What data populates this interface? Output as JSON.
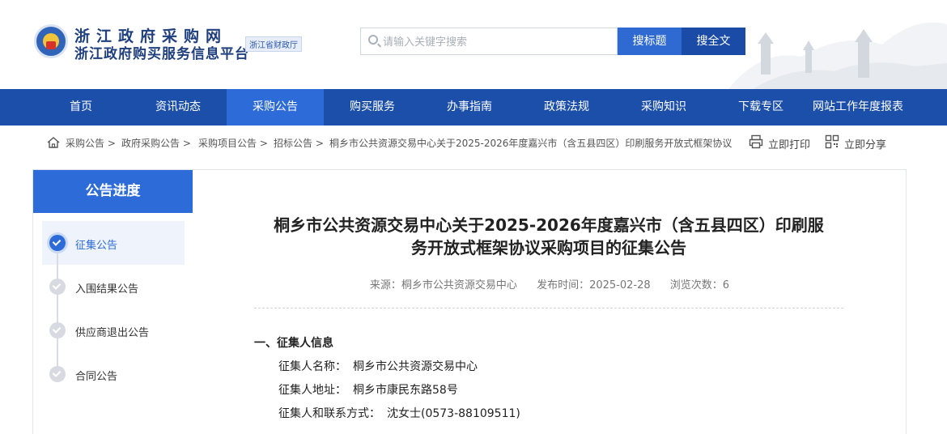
{
  "header": {
    "site_name": "浙江政府采购网",
    "site_sub": "浙江政府购买服务信息平台",
    "badge": "浙江省财政厅",
    "search_placeholder": "请输入关键字搜索",
    "btn_title": "搜标题",
    "btn_full": "搜全文"
  },
  "nav": {
    "items": [
      "首页",
      "资讯动态",
      "采购公告",
      "购买服务",
      "办事指南",
      "政策法规",
      "采购知识",
      "下载专区",
      "网站工作年度报表"
    ],
    "active": "采购公告"
  },
  "breadcrumb": {
    "items": [
      "采购公告 >",
      "政府采购公告 >",
      "采购项目公告 >",
      "招标公告 >",
      "桐乡市公共资源交易中心关于2025-2026年度嘉兴市（含五县四区）印刷服务开放式框架协议"
    ],
    "print": "立即打印",
    "share": "立即分享"
  },
  "side": {
    "title": "公告进度",
    "steps": [
      {
        "label": "征集公告",
        "status": "done"
      },
      {
        "label": "入围结果公告",
        "status": "pending"
      },
      {
        "label": "供应商退出公告",
        "status": "pending"
      },
      {
        "label": "合同公告",
        "status": "pending"
      }
    ]
  },
  "article": {
    "title_line1": "桐乡市公共资源交易中心关于2025-2026年度嘉兴市（含五县四区）印刷服",
    "title_line2": "务开放式框架协议采购项目的征集公告",
    "source": "来源：桐乡市公共资源交易中心",
    "date": "发布时间：2025-02-28",
    "views": "浏览次数：6",
    "section1": "一、征集人信息",
    "fields": [
      {
        "label": "征集人名称：",
        "value": "桐乡市公共资源交易中心"
      },
      {
        "label": "征集人地址：",
        "value": "桐乡市康民东路58号"
      },
      {
        "label": "征集人和联系方式：",
        "value": "沈女士(0573-88109511)"
      }
    ]
  },
  "colors": {
    "nav": "#1c4faa",
    "accent": "#2d6bd8",
    "btn_dark": "#1a4ba6"
  }
}
